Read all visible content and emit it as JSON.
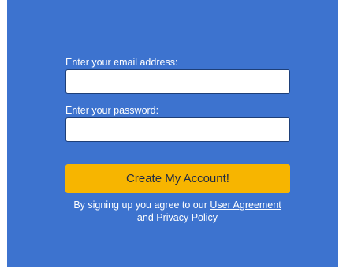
{
  "form": {
    "email_label": "Enter your email address:",
    "email_value": "",
    "password_label": "Enter your password:",
    "password_value": "",
    "submit_label": "Create My Account!"
  },
  "terms": {
    "prefix": "By signing up you agree to our",
    "user_agreement_link": "User Agreement",
    "conjunction": "and",
    "privacy_policy_link": "Privacy Policy"
  },
  "colors": {
    "panel_background": "#3d73cf",
    "button_background": "#f7b500",
    "text": "#ffffff"
  }
}
